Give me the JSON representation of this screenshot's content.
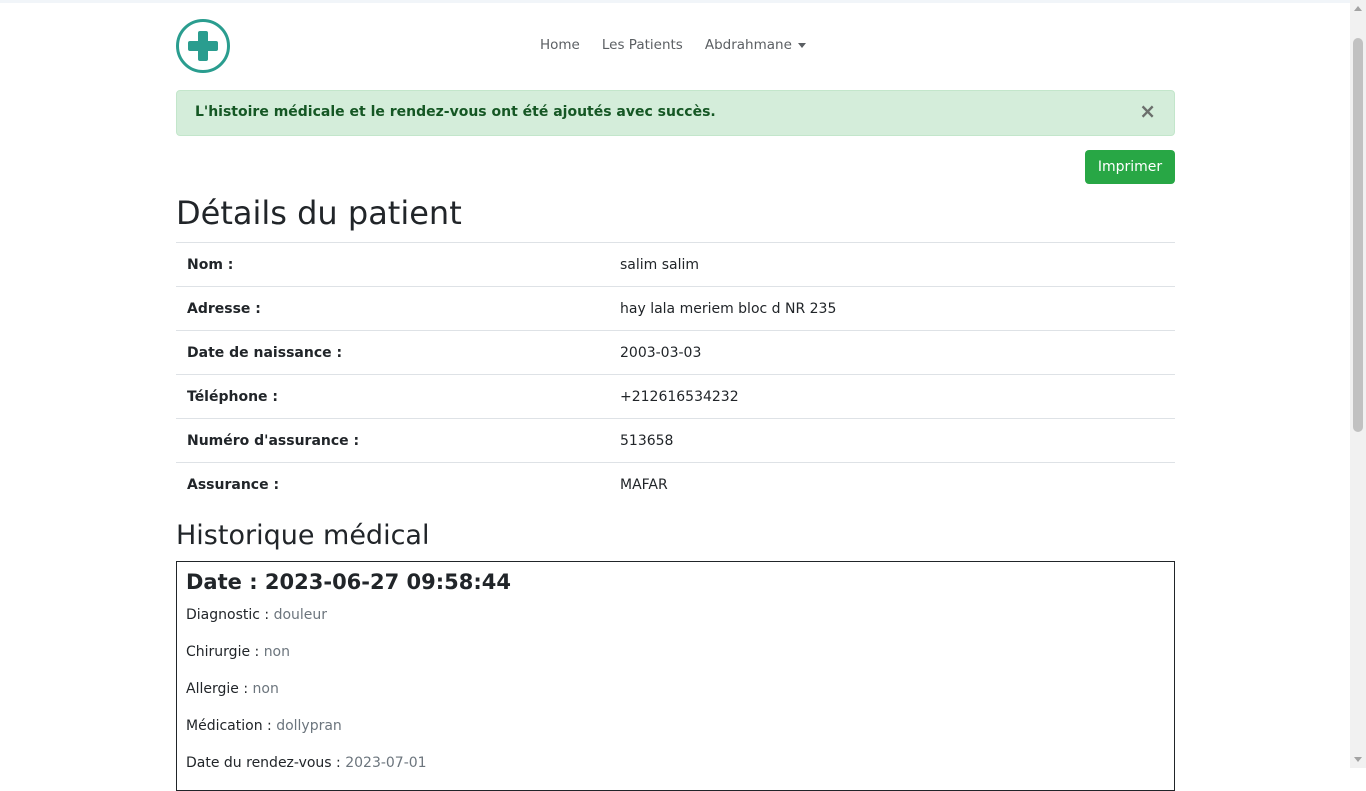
{
  "nav": {
    "links": [
      "Home",
      "Les Patients"
    ],
    "user": "Abdrahmane"
  },
  "alert": {
    "message": "L'histoire médicale et le rendez-vous ont été ajoutés avec succès.",
    "close": "×"
  },
  "print_button": "Imprimer",
  "title": "Détails du patient",
  "details": [
    {
      "label": "Nom :",
      "value": "salim salim"
    },
    {
      "label": "Adresse :",
      "value": "hay lala meriem bloc d NR 235"
    },
    {
      "label": "Date de naissance :",
      "value": "2003-03-03"
    },
    {
      "label": "Téléphone :",
      "value": "+212616534232"
    },
    {
      "label": "Numéro d'assurance :",
      "value": "513658"
    },
    {
      "label": "Assurance :",
      "value": "MAFAR"
    }
  ],
  "history": {
    "title": "Historique médical",
    "date": "Date : 2023-06-27 09:58:44",
    "rows": [
      {
        "label": "Diagnostic :",
        "value": "douleur"
      },
      {
        "label": "Chirurgie :",
        "value": "non"
      },
      {
        "label": "Allergie :",
        "value": "non"
      },
      {
        "label": "Médication :",
        "value": "dollypran"
      },
      {
        "label": "Date du rendez-vous :",
        "value": "2023-07-01"
      }
    ]
  },
  "colors": {
    "brand": "#2a9d8f",
    "success_bg": "#d4edda",
    "success_text": "#155724",
    "button": "#28a745"
  }
}
